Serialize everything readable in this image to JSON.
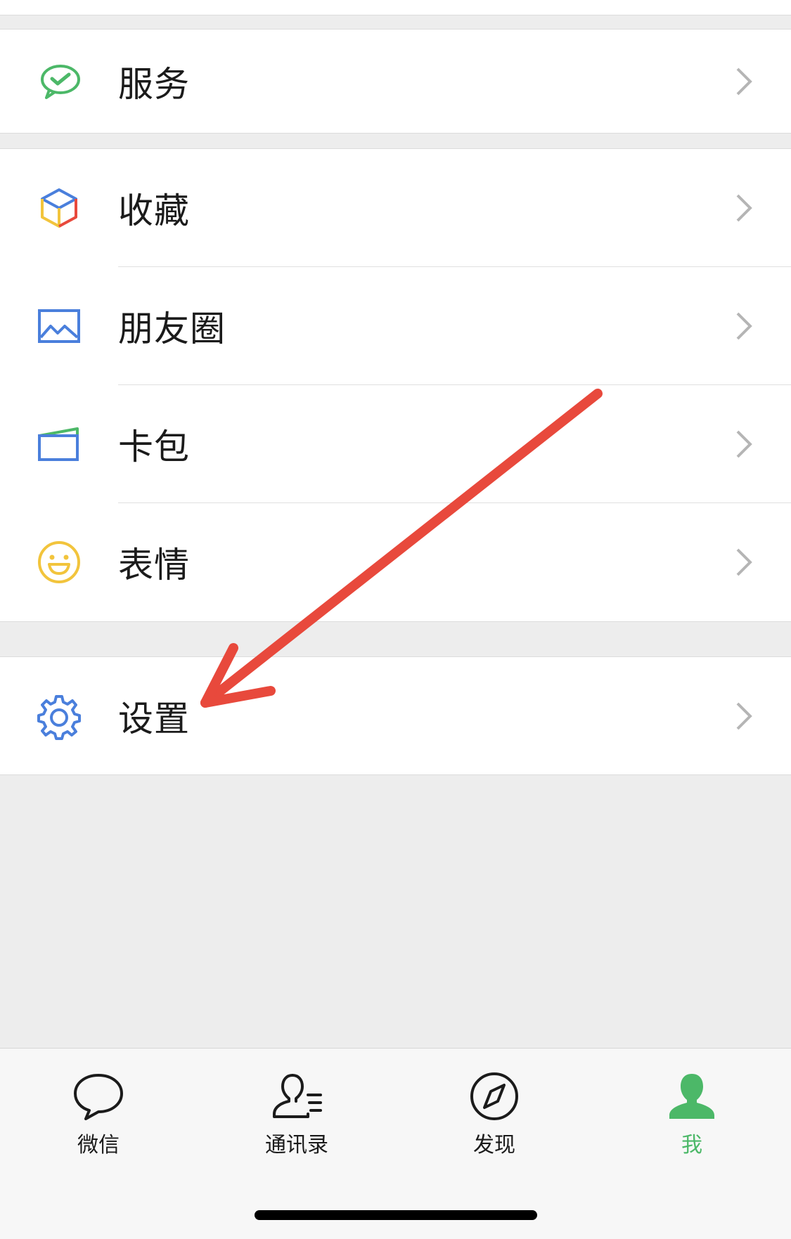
{
  "menu": {
    "service": {
      "label": "服务",
      "icon": "wechat-pay-icon",
      "color": "#4cb868"
    },
    "favorites": {
      "label": "收藏",
      "icon": "cube-icon"
    },
    "moments": {
      "label": "朋友圈",
      "icon": "photo-icon",
      "color": "#4a7fdc"
    },
    "card_wallet": {
      "label": "卡包",
      "icon": "card-icon",
      "color": "#4a7fdc"
    },
    "stickers": {
      "label": "表情",
      "icon": "smiley-icon",
      "color": "#f2c43c"
    },
    "settings": {
      "label": "设置",
      "icon": "gear-icon",
      "color": "#4a7fdc"
    }
  },
  "tabbar": {
    "chats": {
      "label": "微信",
      "icon": "chat-bubble-icon"
    },
    "contacts": {
      "label": "通讯录",
      "icon": "contacts-icon"
    },
    "discover": {
      "label": "发现",
      "icon": "compass-icon"
    },
    "me": {
      "label": "我",
      "icon": "person-icon",
      "active": true
    }
  },
  "colors": {
    "accent": "#4cb868",
    "annotation_arrow": "#e8493c",
    "background": "#ededed"
  }
}
